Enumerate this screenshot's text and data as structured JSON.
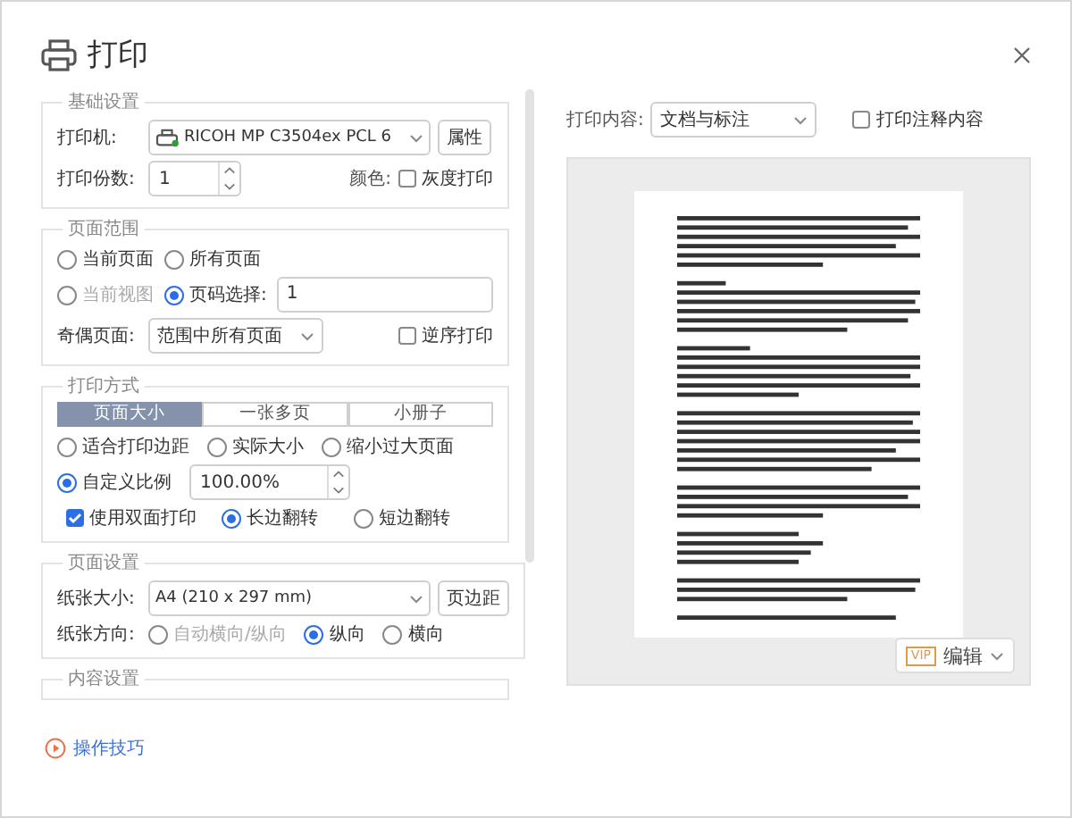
{
  "title": "打印",
  "basic": {
    "legend": "基础设置",
    "printer_label": "打印机:",
    "printer": "RICOH MP C3504ex PCL 6",
    "properties_button": "属性",
    "copies_label": "打印份数:",
    "copies": "1",
    "color_label": "颜色:",
    "grayscale": {
      "label": "灰度打印",
      "checked": false
    }
  },
  "page_range": {
    "legend": "页面范围",
    "options": [
      {
        "label": "当前页面",
        "selected": false,
        "disabled": false
      },
      {
        "label": "所有页面",
        "selected": false,
        "disabled": false
      },
      {
        "label": "当前视图",
        "selected": false,
        "disabled": true
      },
      {
        "label": "页码选择:",
        "selected": true,
        "disabled": false
      }
    ],
    "pages_value": "1",
    "odd_even_label": "奇偶页面:",
    "odd_even": "范围中所有页面",
    "reverse": {
      "label": "逆序打印",
      "checked": false
    }
  },
  "print_mode": {
    "legend": "打印方式",
    "tabs": [
      {
        "label": "页面大小",
        "selected": true
      },
      {
        "label": "一张多页",
        "selected": false
      },
      {
        "label": "小册子",
        "selected": false
      }
    ],
    "scale_options": [
      {
        "label": "适合打印边距",
        "selected": false
      },
      {
        "label": "实际大小",
        "selected": false
      },
      {
        "label": "缩小过大页面",
        "selected": false
      },
      {
        "label": "自定义比例",
        "selected": true
      }
    ],
    "scale_value": "100.00%",
    "duplex": {
      "label": "使用双面打印",
      "checked": true
    },
    "flip_options": [
      {
        "label": "长边翻转",
        "selected": true
      },
      {
        "label": "短边翻转",
        "selected": false
      }
    ]
  },
  "page_setup": {
    "legend": "页面设置",
    "paper_label": "纸张大小:",
    "paper": "A4 (210 x 297 mm)",
    "margins_button": "页边距",
    "orientation_label": "纸张方向:",
    "orientations": [
      {
        "label": "自动横向/纵向",
        "selected": false,
        "disabled": true
      },
      {
        "label": "纵向",
        "selected": true,
        "disabled": false
      },
      {
        "label": "横向",
        "selected": false,
        "disabled": false
      }
    ]
  },
  "content_setup": {
    "legend": "内容设置"
  },
  "tips_link": "操作技巧",
  "preview": {
    "content_label": "打印内容:",
    "content": "文档与标注",
    "annotations": {
      "label": "打印注释内容",
      "checked": false
    },
    "edit_badge": "VIP",
    "edit_button": "编辑"
  }
}
